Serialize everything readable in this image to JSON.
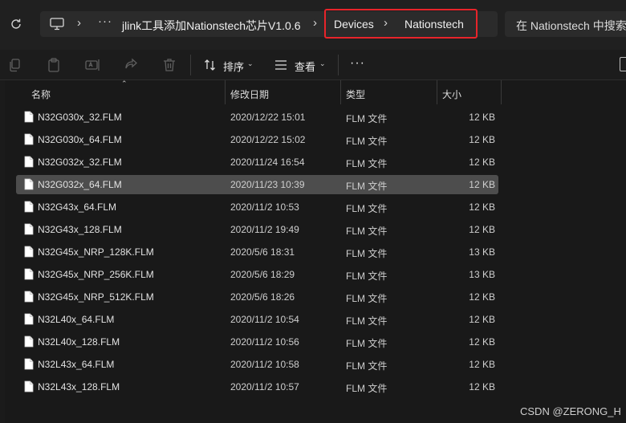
{
  "address_bar": {
    "refresh_icon": "refresh-icon",
    "pc_icon": "monitor-icon",
    "more_label": "···",
    "crumbs": [
      "jlink工具添加Nationstech芯片V1.0.6",
      "Devices",
      "Nationstech"
    ],
    "separator": "›",
    "search_placeholder": "在 Nationstech 中搜索",
    "highlight_color": "#e8242a"
  },
  "toolbar": {
    "icons": [
      "copy-icon",
      "paste-icon",
      "rename-icon",
      "share-icon",
      "delete-icon"
    ],
    "sort_label": "排序",
    "view_label": "查看",
    "more_label": "···"
  },
  "columns": {
    "name": "名称",
    "date": "修改日期",
    "type": "类型",
    "size": "大小"
  },
  "files": [
    {
      "name": "N32G030x_32.FLM",
      "date": "2020/12/22 15:01",
      "type": "FLM 文件",
      "size": "12 KB",
      "selected": false
    },
    {
      "name": "N32G030x_64.FLM",
      "date": "2020/12/22 15:02",
      "type": "FLM 文件",
      "size": "12 KB",
      "selected": false
    },
    {
      "name": "N32G032x_32.FLM",
      "date": "2020/11/24 16:54",
      "type": "FLM 文件",
      "size": "12 KB",
      "selected": false
    },
    {
      "name": "N32G032x_64.FLM",
      "date": "2020/11/23 10:39",
      "type": "FLM 文件",
      "size": "12 KB",
      "selected": true
    },
    {
      "name": "N32G43x_64.FLM",
      "date": "2020/11/2 10:53",
      "type": "FLM 文件",
      "size": "12 KB",
      "selected": false
    },
    {
      "name": "N32G43x_128.FLM",
      "date": "2020/11/2 19:49",
      "type": "FLM 文件",
      "size": "12 KB",
      "selected": false
    },
    {
      "name": "N32G45x_NRP_128K.FLM",
      "date": "2020/5/6 18:31",
      "type": "FLM 文件",
      "size": "13 KB",
      "selected": false
    },
    {
      "name": "N32G45x_NRP_256K.FLM",
      "date": "2020/5/6 18:29",
      "type": "FLM 文件",
      "size": "13 KB",
      "selected": false
    },
    {
      "name": "N32G45x_NRP_512K.FLM",
      "date": "2020/5/6 18:26",
      "type": "FLM 文件",
      "size": "12 KB",
      "selected": false
    },
    {
      "name": "N32L40x_64.FLM",
      "date": "2020/11/2 10:54",
      "type": "FLM 文件",
      "size": "12 KB",
      "selected": false
    },
    {
      "name": "N32L40x_128.FLM",
      "date": "2020/11/2 10:56",
      "type": "FLM 文件",
      "size": "12 KB",
      "selected": false
    },
    {
      "name": "N32L43x_64.FLM",
      "date": "2020/11/2 10:58",
      "type": "FLM 文件",
      "size": "12 KB",
      "selected": false
    },
    {
      "name": "N32L43x_128.FLM",
      "date": "2020/11/2 10:57",
      "type": "FLM 文件",
      "size": "12 KB",
      "selected": false
    }
  ],
  "watermark": "CSDN @ZERONG_H"
}
